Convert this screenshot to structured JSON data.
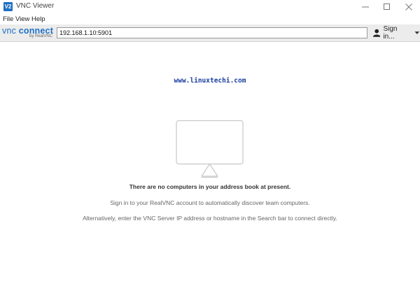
{
  "window": {
    "title": "VNC Viewer",
    "app_icon_text": "V2"
  },
  "menu": {
    "items": [
      "File",
      "View",
      "Help"
    ]
  },
  "toolbar": {
    "logo_main_thin": "vnc ",
    "logo_main_bold": "connect",
    "logo_sub": "by RealVNC",
    "address_value": "192.168.1.10:5901",
    "signin_label": "Sign in..."
  },
  "watermark": "www.linuxtechi.com",
  "empty_state": {
    "heading": "There are no computers in your address book at present.",
    "line1": "Sign in to your RealVNC account to automatically discover team computers.",
    "line2": "Alternatively, enter the VNC Server IP address or hostname in the Search bar to connect directly."
  },
  "colors": {
    "brand": "#1f6fc4",
    "toolbar_bg": "#ececec",
    "watermark": "#1a3ea0"
  }
}
